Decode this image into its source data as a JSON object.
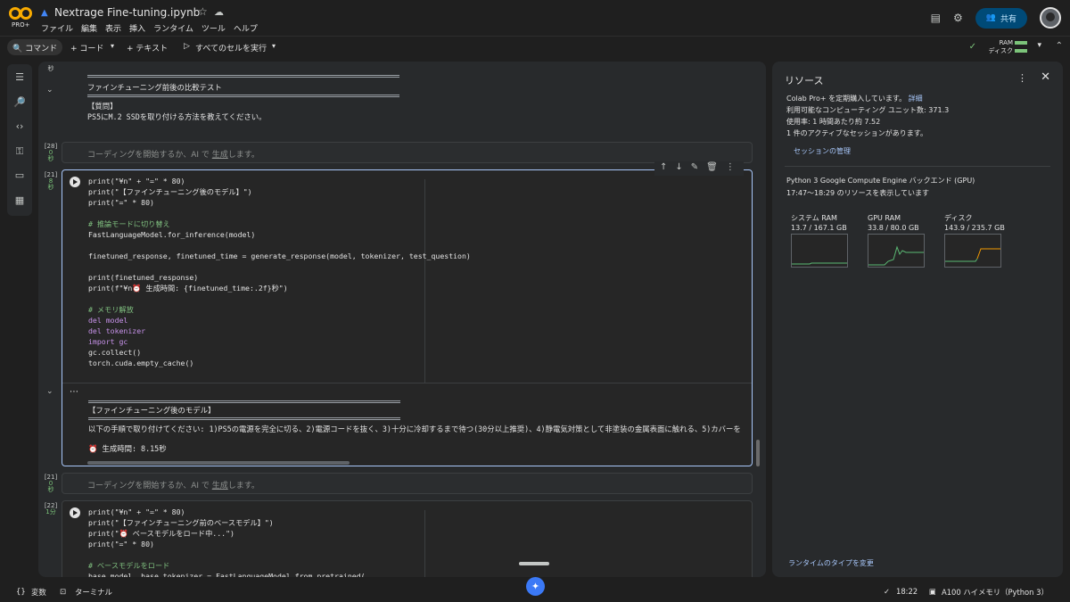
{
  "header": {
    "badge": "PRO+",
    "title": "Nextrage Fine-tuning.ipynb",
    "menu": [
      "ファイル",
      "編集",
      "表示",
      "挿入",
      "ランタイム",
      "ツール",
      "ヘルプ"
    ],
    "share_label": "共有"
  },
  "toolbar": {
    "command_label": "コマンド",
    "add_code_label": "+ コード",
    "add_text_label": "+ テキスト",
    "run_all_label": "すべてのセルを実行",
    "ram_label": "RAM",
    "disk_label": "ディスク"
  },
  "cells": {
    "c0_time": "秒",
    "c0_output_title": "ファインチューニング前後の比較テスト",
    "c0_question_header": "【質問】",
    "c0_question": "PS5にM.2 SSDを取り付ける方法を教えてください。",
    "empty_placeholder_pre": "コーディングを開始するか、AI で",
    "empty_placeholder_link": "生成",
    "empty_placeholder_post": "します。",
    "c1_num": "[28]",
    "c1_time": "0\n秒",
    "c2_num": "[21]",
    "c2_time": "8\n秒",
    "c2_code": [
      "print(\"¥n\" + \"=\" * 80)",
      "print(\"【ファインチューニング後のモデル】\")",
      "print(\"=\" * 80)",
      "",
      "# 推論モードに切り替え",
      "FastLanguageModel.for_inference(model)",
      "",
      "finetuned_response, finetuned_time = generate_response(model, tokenizer, test_question)",
      "",
      "print(finetuned_response)",
      "print(f\"¥n⏰ 生成時間: {finetuned_time:.2f}秒\")",
      "",
      "# メモリ解放",
      "del model",
      "del tokenizer",
      "import gc",
      "gc.collect()",
      "torch.cuda.empty_cache()"
    ],
    "c2_out_header": "【ファインチューニング後のモデル】",
    "c2_out_body": "以下の手順で取り付けてください: 1)PS5の電源を完全に切る、2)電源コードを抜く、3)十分に冷却するまで待つ(30分以上推奨)、4)静電気対策として非塗装の金属表面に触れる、5)カバーを",
    "c2_out_time": "⏰ 生成時間: 8.15秒",
    "c3_num": "[21]",
    "c3_time": "0\n秒",
    "c4_num": "[22]",
    "c4_time": "1分",
    "c4_code": [
      "print(\"¥n\" + \"=\" * 80)",
      "print(\"【ファインチューニング前のベースモデル】\")",
      "print(\"⏰ ベースモデルをロード中...\")",
      "print(\"=\" * 80)",
      "",
      "# ベースモデルをロード",
      "base_model, base_tokenizer = FastLanguageModel.from_pretrained("
    ]
  },
  "resources": {
    "title": "リソース",
    "plan_text": "Colab Pro+ を定期購入しています。",
    "plan_link": "詳細",
    "units_text": "利用可能なコンピューティング ユニット数: 371.3",
    "usage_text": "使用率: 1 時間あたり約 7.52",
    "sessions_text": "1 件のアクティブなセッションがあります。",
    "manage_sessions": "セッションの管理",
    "backend_text": "Python 3 Google Compute Engine バックエンド (GPU)",
    "range_text": "17:47〜18:29 のリソースを表示しています",
    "graphs": [
      {
        "label": "システム RAM",
        "value": "13.7 / 167.1 GB",
        "color": "#5bb974",
        "usage": 0.082
      },
      {
        "label": "GPU RAM",
        "value": "33.8 / 80.0 GB",
        "color": "#5bb974",
        "usage": 0.42
      },
      {
        "label": "ディスク",
        "value": "143.9 / 235.7 GB",
        "color": "#f29900",
        "usage": 0.61
      }
    ],
    "change_runtime": "ランタイムのタイプを変更"
  },
  "statusbar": {
    "variables": "変数",
    "terminal": "ターミナル",
    "time": "18:22",
    "runtime": "A100 ハイメモリ（Python 3）"
  }
}
